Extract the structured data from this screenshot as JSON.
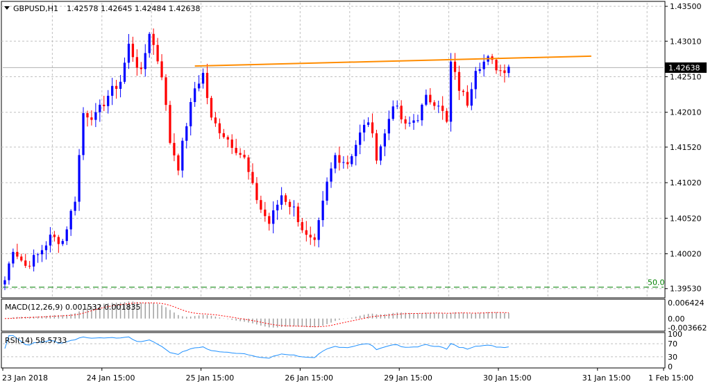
{
  "header": {
    "symbol": "GBPUSD,H1",
    "ohlc": "1.42578 1.42645 1.42484 1.42638"
  },
  "indicators": {
    "macd_label": "MACD(12,26,9) 0.001532 0.001835",
    "rsi_label": "RSI(14) 58.5733"
  },
  "colors": {
    "bull": "#0000ff",
    "bear": "#ff0000",
    "trendline": "#ff8c00",
    "fib_line": "#008000",
    "grid": "#c0c0c0",
    "rsi_line": "#1e90ff",
    "macd_signal": "#ff0000",
    "macd_hist": "#a0a0a0"
  },
  "chart_data": {
    "type": "candlestick",
    "price_ticks": [
      "1.43500",
      "1.43010",
      "1.42510",
      "1.42010",
      "1.41520",
      "1.41020",
      "1.40520",
      "1.40020",
      "1.39530"
    ],
    "price_range": [
      1.3942,
      1.4355
    ],
    "current_price": "1.42638",
    "fib_label": "50.0",
    "fib_level": 1.3955,
    "macd_ticks": [
      "0.006424",
      "0.00",
      "-0.003662"
    ],
    "rsi_ticks": [
      "100",
      "70",
      "30",
      "0"
    ],
    "x_labels": [
      "23 Jan 2018",
      "24 Jan 15:00",
      "25 Jan 15:00",
      "26 Jan 15:00",
      "29 Jan 15:00",
      "30 Jan 15:00",
      "31 Jan 15:00",
      "1 Feb 15:00"
    ],
    "trendline": [
      {
        "bar": 46,
        "price": 1.4266
      },
      {
        "bar": 142,
        "price": 1.428
      }
    ],
    "macd_range": [
      -0.0045,
      0.0072
    ],
    "anchors": [
      [
        0,
        1.3965
      ],
      [
        2,
        1.401
      ],
      [
        5,
        1.3985
      ],
      [
        8,
        1.4
      ],
      [
        11,
        1.4025
      ],
      [
        14,
        1.402
      ],
      [
        17,
        1.408
      ],
      [
        19,
        1.42
      ],
      [
        22,
        1.4195
      ],
      [
        25,
        1.4225
      ],
      [
        28,
        1.4245
      ],
      [
        30,
        1.4295
      ],
      [
        33,
        1.4255
      ],
      [
        35,
        1.4315
      ],
      [
        38,
        1.4255
      ],
      [
        40,
        1.416
      ],
      [
        42,
        1.4125
      ],
      [
        44,
        1.4185
      ],
      [
        46,
        1.4235
      ],
      [
        48,
        1.4255
      ],
      [
        50,
        1.419
      ],
      [
        53,
        1.417
      ],
      [
        56,
        1.415
      ],
      [
        58,
        1.4135
      ],
      [
        60,
        1.4095
      ],
      [
        62,
        1.4065
      ],
      [
        64,
        1.4045
      ],
      [
        67,
        1.4085
      ],
      [
        70,
        1.4065
      ],
      [
        73,
        1.4025
      ],
      [
        75,
        1.4015
      ],
      [
        78,
        1.41
      ],
      [
        80,
        1.414
      ],
      [
        83,
        1.413
      ],
      [
        86,
        1.417
      ],
      [
        88,
        1.419
      ],
      [
        90,
        1.414
      ],
      [
        92,
        1.417
      ],
      [
        94,
        1.4215
      ],
      [
        97,
        1.418
      ],
      [
        100,
        1.4195
      ],
      [
        102,
        1.422
      ],
      [
        105,
        1.4215
      ],
      [
        107,
        1.4185
      ],
      [
        108,
        1.427
      ],
      [
        110,
        1.4235
      ],
      [
        112,
        1.4215
      ],
      [
        114,
        1.4265
      ],
      [
        117,
        1.4275
      ],
      [
        120,
        1.426
      ],
      [
        122,
        1.4265
      ]
    ]
  }
}
